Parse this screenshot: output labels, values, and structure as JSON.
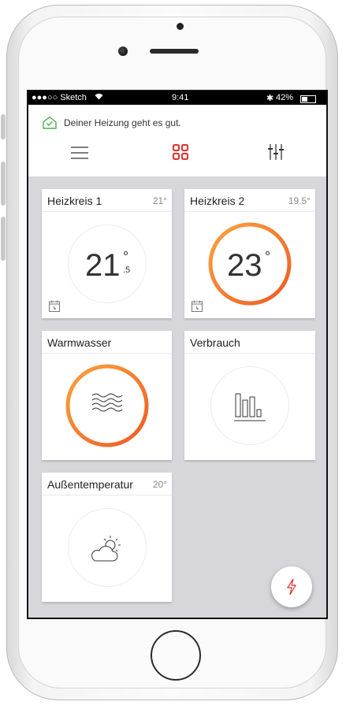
{
  "status_bar": {
    "carrier": "●●●○○ Sketch",
    "time": "9:41",
    "battery": "42%"
  },
  "header": {
    "status_message": "Deiner Heizung geht es gut."
  },
  "nav": {
    "menu_icon": "hamburger-icon",
    "grid_icon": "grid-icon",
    "settings_icon": "sliders-icon",
    "accent_color": "#e0322f"
  },
  "tiles": {
    "heizkreis1": {
      "title": "Heizkreis 1",
      "temp": "21°",
      "value": "21",
      "decimal": ".5",
      "degree": "°"
    },
    "heizkreis2": {
      "title": "Heizkreis 2",
      "temp": "19.5°",
      "value": "23",
      "degree": "°"
    },
    "warmwasser": {
      "title": "Warmwasser"
    },
    "verbrauch": {
      "title": "Verbrauch"
    },
    "aussen": {
      "title": "Außentemperatur",
      "temp": "20°"
    }
  },
  "colors": {
    "ring_gradient_start": "#f9a440",
    "ring_gradient_end": "#ee5a24",
    "background": "#d7d7db"
  }
}
